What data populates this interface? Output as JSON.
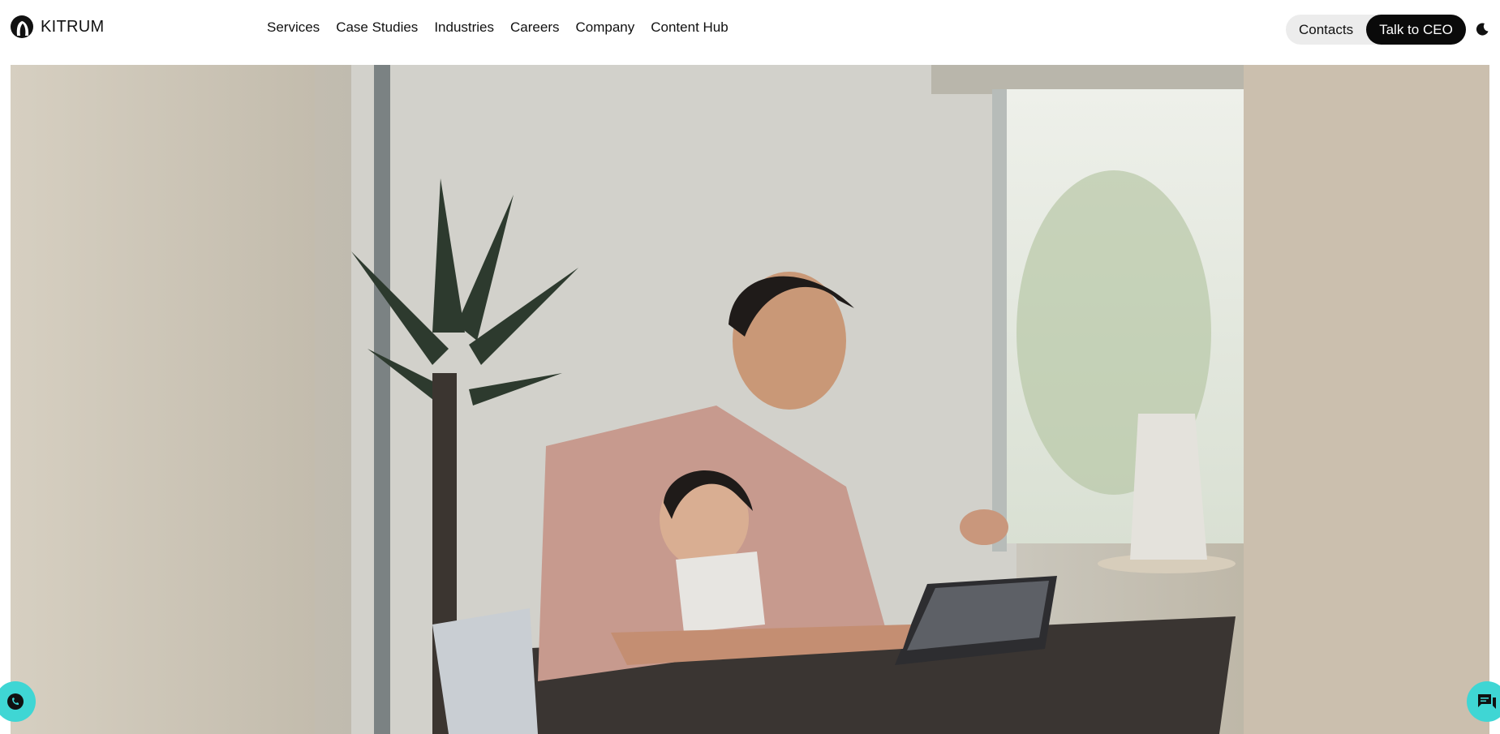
{
  "brand": {
    "name": "KITRUM",
    "logo_icon": "kitrum-logo-icon"
  },
  "nav": {
    "items": [
      {
        "label": "Services"
      },
      {
        "label": "Case Studies"
      },
      {
        "label": "Industries"
      },
      {
        "label": "Careers"
      },
      {
        "label": "Company"
      },
      {
        "label": "Content Hub"
      }
    ]
  },
  "actions": {
    "contacts_label": "Contacts",
    "talk_to_ceo_label": "Talk to CEO",
    "theme_icon": "moon-icon"
  },
  "hero": {
    "image_alt": "Father holding a toddler while using a tablet at a wooden table by a window"
  },
  "floating": {
    "whatsapp_icon": "whatsapp-icon",
    "chat_icon": "chat-icon"
  },
  "colors": {
    "accent": "#3fd6d4",
    "cta_dark": "#0a0a0a",
    "cta_group_bg": "#ececec"
  }
}
